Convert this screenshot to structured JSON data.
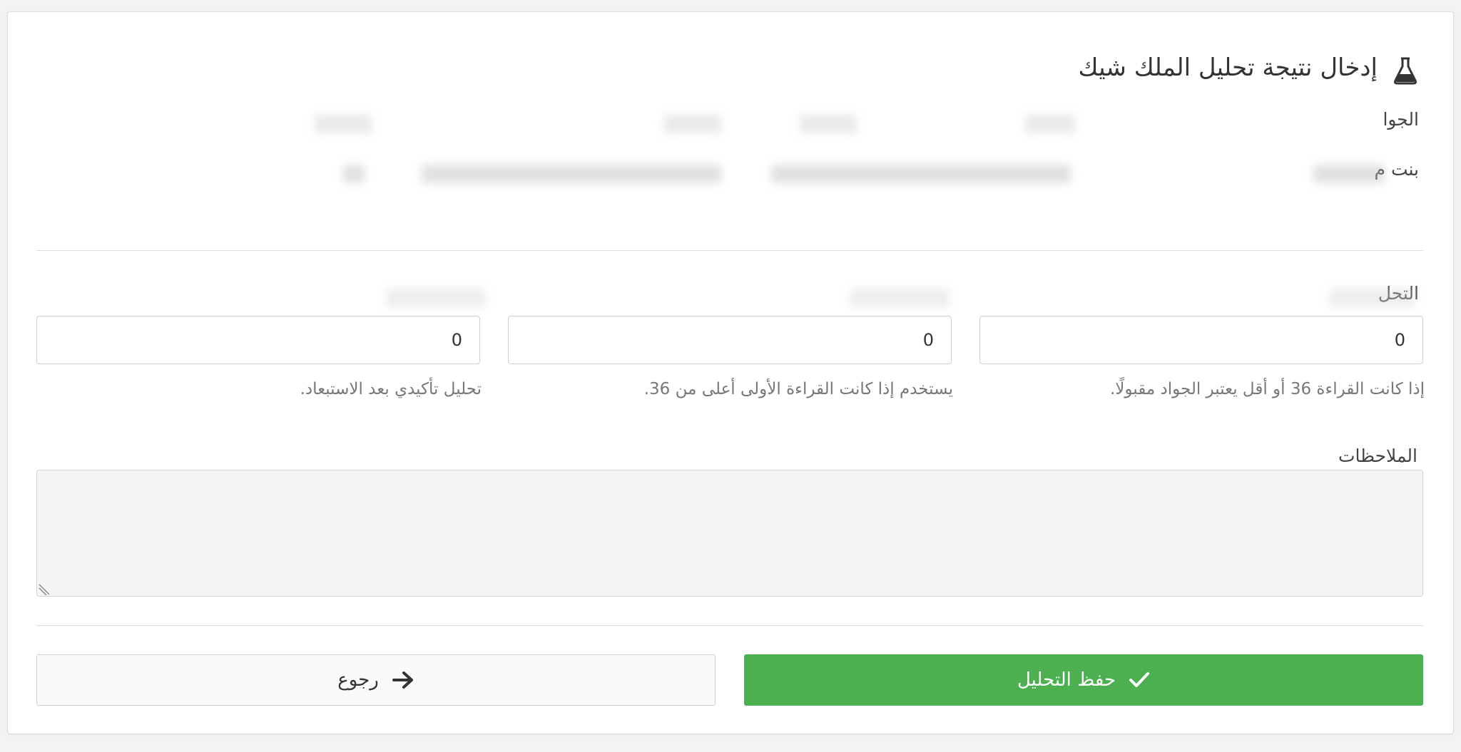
{
  "page": {
    "title": "إدخال نتيجة تحليل الملك شيك",
    "info_header_partial": "الجوا",
    "info_value_partial": "بنت م",
    "section_label_partial": "التحل",
    "blurred_headers": [
      "",
      "",
      "",
      ""
    ],
    "blurred_values": [
      "",
      "",
      "",
      ""
    ]
  },
  "readings": {
    "values": [
      "0",
      "0",
      "0"
    ],
    "help": [
      "إذا كانت القراءة 36 أو أقل يعتبر الجواد مقبولًا.",
      "يستخدم إذا كانت القراءة الأولى أعلى من 36.",
      "تحليل تأكيدي بعد الاستبعاد."
    ]
  },
  "notes": {
    "label": "الملاحظات",
    "value": ""
  },
  "actions": {
    "save_label": "حفظ التحليل",
    "back_label": "رجوع"
  },
  "colors": {
    "save": "#4caf50",
    "card": "#ffffff",
    "page": "#f3f3f3"
  },
  "icons": [
    "flask-icon",
    "check-icon",
    "arrow-right-icon"
  ]
}
